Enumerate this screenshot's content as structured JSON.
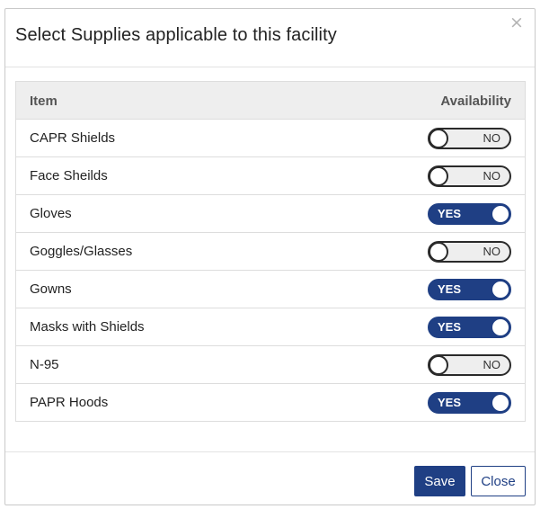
{
  "dialog": {
    "title": "Select Supplies applicable to this facility",
    "close_glyph": "×"
  },
  "table": {
    "headers": {
      "item": "Item",
      "availability": "Availability"
    },
    "rows": [
      {
        "item": "CAPR Shields",
        "available": false,
        "toggle_label": "NO"
      },
      {
        "item": "Face Sheilds",
        "available": false,
        "toggle_label": "NO"
      },
      {
        "item": "Gloves",
        "available": true,
        "toggle_label": "YES"
      },
      {
        "item": "Goggles/Glasses",
        "available": false,
        "toggle_label": "NO"
      },
      {
        "item": "Gowns",
        "available": true,
        "toggle_label": "YES"
      },
      {
        "item": "Masks with Shields",
        "available": true,
        "toggle_label": "YES"
      },
      {
        "item": "N-95",
        "available": false,
        "toggle_label": "NO"
      },
      {
        "item": "PAPR Hoods",
        "available": true,
        "toggle_label": "YES"
      }
    ]
  },
  "footer": {
    "save_label": "Save",
    "close_label": "Close"
  },
  "colors": {
    "primary": "#1f3f84",
    "toggle_off_bg": "#eeeeee",
    "header_bg": "#eeeeee"
  },
  "icons": {
    "close": "close-icon"
  }
}
